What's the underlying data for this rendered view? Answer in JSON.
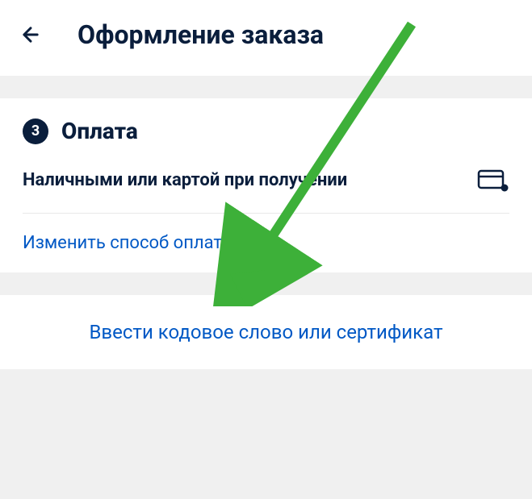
{
  "header": {
    "title": "Оформление заказа"
  },
  "payment": {
    "step_number": "3",
    "section_title": "Оплата",
    "method_label": "Наличными или картой при получении",
    "change_link": "Изменить способ оплаты"
  },
  "promo": {
    "link_text": "Ввести кодовое слово или сертификат"
  },
  "colors": {
    "primary_dark": "#0a1e3c",
    "link_blue": "#0058c5",
    "arrow_green": "#3db039"
  }
}
